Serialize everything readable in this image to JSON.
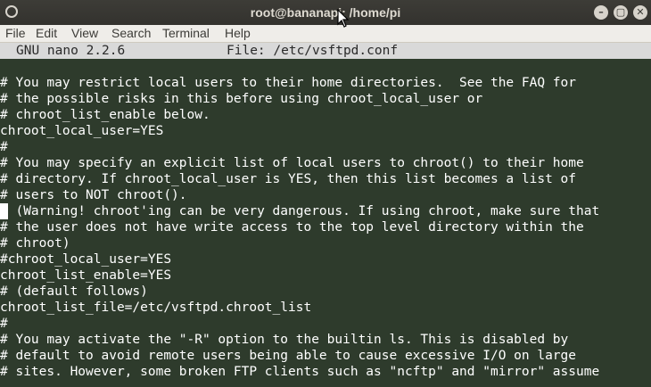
{
  "window": {
    "title": "root@bananapi: /home/pi",
    "minimize_glyph": "–",
    "maximize_glyph": "▢",
    "close_glyph": "✕"
  },
  "menu": {
    "items": [
      "File",
      "Edit",
      "View",
      "Search",
      "Terminal",
      "Help"
    ]
  },
  "nano": {
    "version": "GNU nano 2.2.6",
    "file_label": "File: /etc/vsftpd.conf"
  },
  "content": {
    "lines": [
      "# You may restrict local users to their home directories.  See the FAQ for",
      "# the possible risks in this before using chroot_local_user or",
      "# chroot_list_enable below.",
      "chroot_local_user=YES",
      "#",
      "# You may specify an explicit list of local users to chroot() to their home",
      "# directory. If chroot_local_user is YES, then this list becomes a list of",
      "# users to NOT chroot().",
      "# (Warning! chroot'ing can be very dangerous. If using chroot, make sure that",
      "# the user does not have write access to the top level directory within the",
      "# chroot)",
      "#chroot_local_user=YES",
      "chroot_list_enable=YES",
      "# (default follows)",
      "chroot_list_file=/etc/vsftpd.chroot_list",
      "#",
      "# You may activate the \"-R\" option to the builtin ls. This is disabled by",
      "# default to avoid remote users being able to cause excessive I/O on large",
      "# sites. However, some broken FTP clients such as \"ncftp\" and \"mirror\" assume"
    ]
  },
  "colors": {
    "terminal_bg": "#2e3b2c",
    "terminal_fg": "#ffffff",
    "header_bg": "#d9d9d9",
    "titlebar_bg": "#3a3935",
    "menubar_bg": "#efede9"
  }
}
